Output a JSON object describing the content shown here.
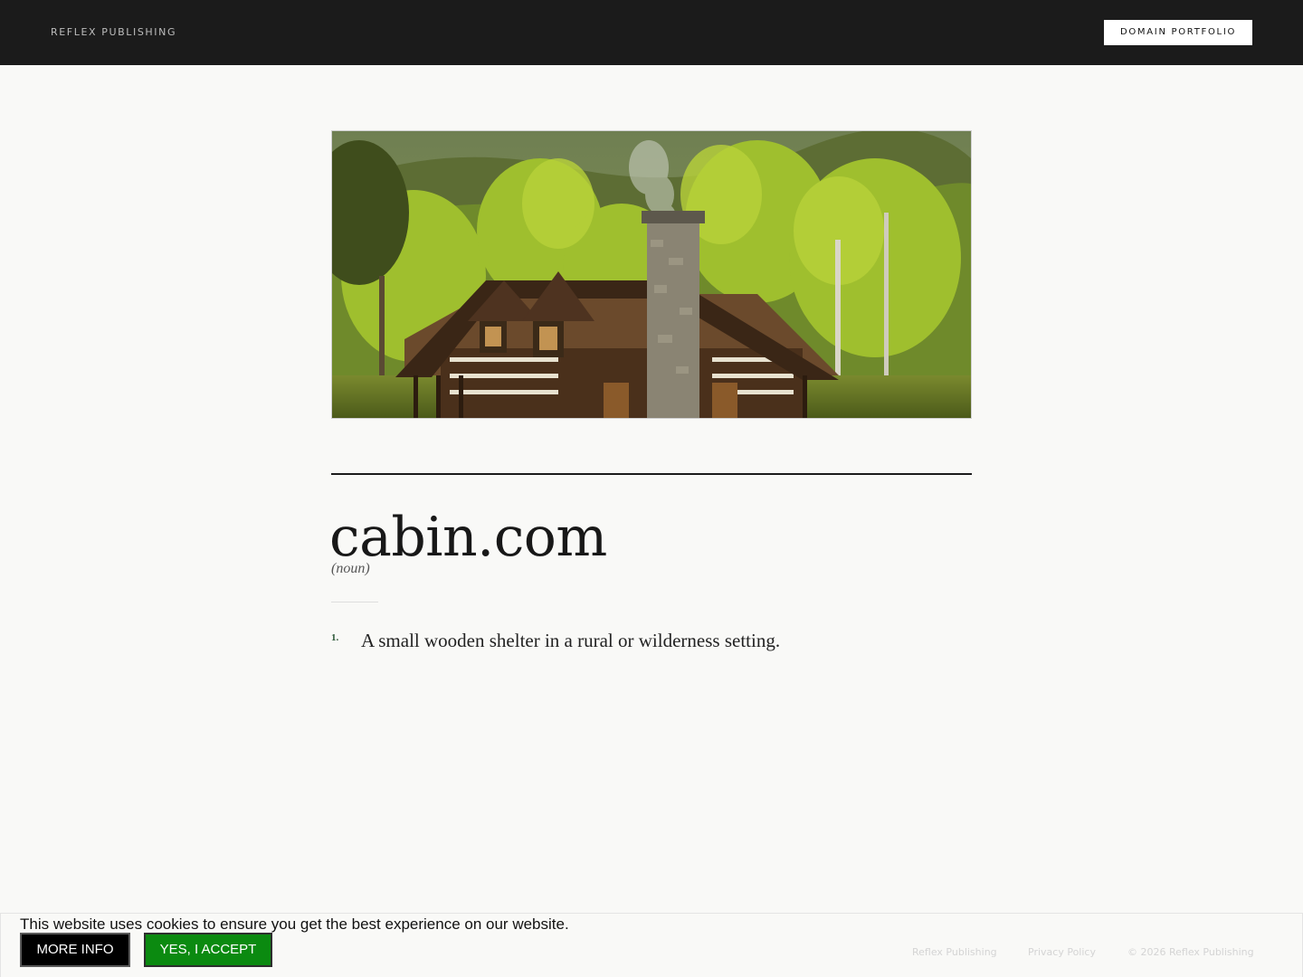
{
  "header": {
    "brand": "REFLEX PUBLISHING",
    "portfolio_button": "DOMAIN PORTFOLIO",
    "background_color": "#1b1b1b"
  },
  "hero_image": {
    "subject": "log cabin with stone chimney in a green forest"
  },
  "entry": {
    "domain": "cabin.com",
    "part_of_speech": "(noun)",
    "definitions": [
      {
        "number": "1.",
        "text": "A small wooden shelter in a rural or wilderness setting."
      }
    ]
  },
  "footer": {
    "links": [
      {
        "label": "Reflex Publishing"
      },
      {
        "label": "Privacy Policy"
      },
      {
        "label": "© 2026 Reflex Publishing"
      }
    ]
  },
  "cookie_banner": {
    "message": "This website uses cookies to ensure you get the best experience on our website.",
    "more_info_label": "MORE INFO",
    "accept_label": "YES, I ACCEPT",
    "accept_color": "#0b8a10"
  }
}
